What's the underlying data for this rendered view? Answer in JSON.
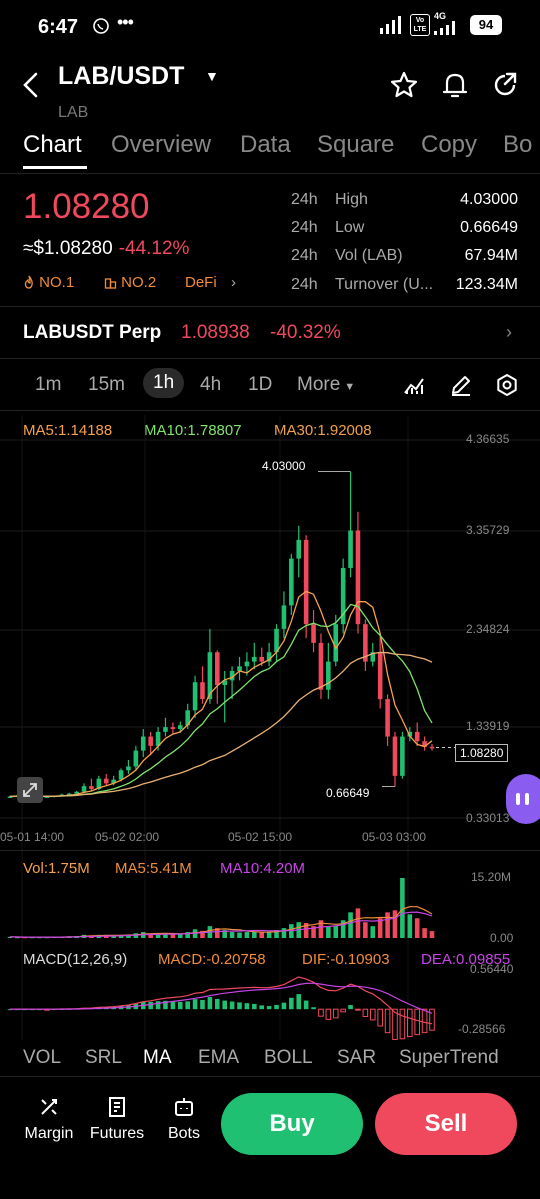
{
  "status_bar": {
    "time": "6:47",
    "network": "4G",
    "volte": "Vo LTE",
    "battery": "94"
  },
  "header": {
    "pair": "LAB/USDT",
    "subtitle": "LAB"
  },
  "tabs": [
    "Chart",
    "Overview",
    "Data",
    "Square",
    "Copy",
    "Bo"
  ],
  "ticker": {
    "last_price": "1.08280",
    "approx": "≈$1.08280",
    "change": "-44.12%",
    "tags": [
      "NO.1",
      "NO.2",
      "DeFi"
    ],
    "stats": [
      {
        "period": "24h",
        "label": "High",
        "value": "4.03000"
      },
      {
        "period": "24h",
        "label": "Low",
        "value": "0.66649"
      },
      {
        "period": "24h",
        "label": "Vol (LAB)",
        "value": "67.94M"
      },
      {
        "period": "24h",
        "label": "Turnover (U...",
        "value": "123.34M"
      }
    ]
  },
  "perp": {
    "name": "LABUSDT Perp",
    "price": "1.08938",
    "change": "-40.32%"
  },
  "intervals": [
    "1m",
    "15m",
    "1h",
    "4h",
    "1D",
    "More"
  ],
  "active_interval": "1h",
  "ma_legend": {
    "ma5": "MA5:1.14188",
    "ma10": "MA10:1.78807",
    "ma30": "MA30:1.92008"
  },
  "price_axis": [
    "4.36635",
    "3.35729",
    "2.34824",
    "1.33919",
    "0.33013"
  ],
  "time_axis": [
    "05-01 14:00",
    "05-02 02:00",
    "05-02 15:00",
    "05-03 03:00"
  ],
  "annotations": {
    "high": "4.03000",
    "low": "0.66649",
    "current": "1.08280"
  },
  "volume_legend": {
    "vol": "Vol:1.75M",
    "ma5": "MA5:5.41M",
    "ma10": "MA10:4.20M"
  },
  "volume_axis": [
    "15.20M",
    "0.00"
  ],
  "macd_legend": {
    "macd": "MACD(12,26,9)",
    "macd_val": "MACD:-0.20758",
    "dif": "DIF:-0.10903",
    "dea": "DEA:0.09855"
  },
  "macd_axis": [
    "0.56440",
    "-0.28566"
  ],
  "indicator_tabs": [
    "VOL",
    "SRL",
    "MA",
    "EMA",
    "BOLL",
    "SAR",
    "SuperTrend"
  ],
  "active_indicator": "MA",
  "bottom_nav": [
    "Margin",
    "Futures",
    "Bots"
  ],
  "actions": {
    "buy": "Buy",
    "sell": "Sell"
  },
  "colors": {
    "up": "#20c073",
    "down": "#f0495d",
    "ma5": "#f7a14b",
    "ma10": "#7ee36b",
    "ma30": "#f0a14b",
    "accent": "#f08c3c"
  },
  "chart_data": {
    "type": "candlestick",
    "x_labels": [
      "05-01 14:00",
      "05-02 02:00",
      "05-02 15:00",
      "05-03 03:00"
    ],
    "ylim": [
      0.33013,
      4.36635
    ],
    "candles": [
      [
        0.56,
        0.57,
        0.55,
        0.56
      ],
      [
        0.56,
        0.58,
        0.55,
        0.57
      ],
      [
        0.57,
        0.58,
        0.56,
        0.56
      ],
      [
        0.56,
        0.57,
        0.55,
        0.56
      ],
      [
        0.56,
        0.57,
        0.55,
        0.56
      ],
      [
        0.56,
        0.57,
        0.55,
        0.56
      ],
      [
        0.56,
        0.57,
        0.55,
        0.57
      ],
      [
        0.57,
        0.59,
        0.56,
        0.58
      ],
      [
        0.58,
        0.6,
        0.57,
        0.59
      ],
      [
        0.59,
        0.62,
        0.58,
        0.61
      ],
      [
        0.61,
        0.7,
        0.6,
        0.67
      ],
      [
        0.67,
        0.75,
        0.62,
        0.64
      ],
      [
        0.64,
        0.78,
        0.63,
        0.75
      ],
      [
        0.75,
        0.8,
        0.68,
        0.7
      ],
      [
        0.7,
        0.78,
        0.68,
        0.74
      ],
      [
        0.74,
        0.86,
        0.72,
        0.84
      ],
      [
        0.84,
        0.95,
        0.8,
        0.88
      ],
      [
        0.88,
        1.1,
        0.85,
        1.05
      ],
      [
        1.05,
        1.28,
        0.98,
        1.2
      ],
      [
        1.2,
        1.25,
        1.0,
        1.1
      ],
      [
        1.1,
        1.3,
        1.05,
        1.25
      ],
      [
        1.25,
        1.4,
        1.2,
        1.3
      ],
      [
        1.3,
        1.35,
        1.22,
        1.28
      ],
      [
        1.28,
        1.36,
        1.24,
        1.32
      ],
      [
        1.32,
        1.55,
        1.28,
        1.48
      ],
      [
        1.48,
        1.85,
        1.4,
        1.78
      ],
      [
        1.78,
        1.95,
        1.55,
        1.6
      ],
      [
        1.6,
        2.35,
        1.55,
        2.1
      ],
      [
        2.1,
        2.12,
        1.55,
        1.75
      ],
      [
        1.75,
        1.9,
        1.35,
        1.8
      ],
      [
        1.8,
        1.95,
        1.6,
        1.9
      ],
      [
        1.9,
        2.05,
        1.8,
        1.95
      ],
      [
        1.95,
        2.1,
        1.85,
        2.0
      ],
      [
        2.0,
        2.2,
        1.92,
        2.05
      ],
      [
        2.05,
        2.15,
        1.95,
        2.0
      ],
      [
        2.0,
        2.2,
        1.95,
        2.1
      ],
      [
        2.1,
        2.4,
        2.0,
        2.35
      ],
      [
        2.35,
        2.75,
        2.25,
        2.6
      ],
      [
        2.6,
        3.15,
        2.5,
        3.1
      ],
      [
        3.1,
        3.45,
        2.9,
        3.3
      ],
      [
        3.3,
        3.35,
        2.25,
        2.4
      ],
      [
        2.4,
        2.55,
        2.1,
        2.2
      ],
      [
        2.2,
        2.3,
        1.6,
        1.7
      ],
      [
        1.7,
        2.2,
        1.6,
        2.0
      ],
      [
        2.0,
        2.5,
        1.95,
        2.4
      ],
      [
        2.4,
        3.1,
        2.3,
        3.0
      ],
      [
        3.0,
        4.03,
        2.9,
        3.4
      ],
      [
        3.4,
        3.6,
        2.3,
        2.4
      ],
      [
        2.4,
        2.45,
        1.9,
        2.0
      ],
      [
        2.0,
        2.2,
        1.95,
        2.1
      ],
      [
        2.1,
        2.3,
        1.5,
        1.6
      ],
      [
        1.6,
        1.65,
        1.1,
        1.2
      ],
      [
        1.2,
        1.25,
        0.66649,
        0.78
      ],
      [
        0.78,
        1.25,
        0.75,
        1.2
      ],
      [
        1.2,
        1.3,
        1.15,
        1.25
      ],
      [
        1.25,
        1.35,
        1.1,
        1.15
      ],
      [
        1.15,
        1.2,
        1.05,
        1.09
      ],
      [
        1.09,
        1.12,
        1.05,
        1.0828
      ]
    ],
    "volume": [
      0.3,
      0.2,
      0.2,
      0.2,
      0.2,
      0.2,
      0.3,
      0.3,
      0.4,
      0.5,
      0.8,
      0.6,
      0.8,
      0.6,
      0.6,
      0.8,
      0.9,
      1.2,
      1.5,
      1.0,
      1.1,
      1.2,
      0.9,
      1.0,
      1.5,
      2.2,
      1.8,
      3.0,
      2.5,
      2.0,
      1.5,
      1.4,
      1.5,
      1.6,
      1.4,
      1.6,
      2.0,
      2.5,
      3.5,
      4.0,
      3.8,
      3.0,
      4.5,
      2.8,
      3.2,
      4.5,
      6.5,
      7.5,
      4.0,
      3.0,
      5.0,
      6.5,
      7.0,
      15.2,
      6.0,
      5.0,
      2.5,
      1.75
    ],
    "ma5_last": 1.14188,
    "ma10_last": 1.78807,
    "ma30_last": 1.92008
  }
}
